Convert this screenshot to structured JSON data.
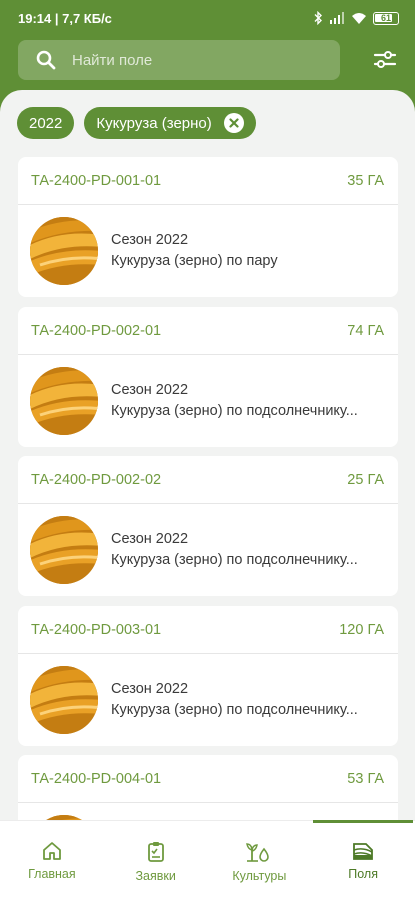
{
  "status_bar": {
    "time_speed": "19:14 | 7,7 КБ/с",
    "battery": "61"
  },
  "search": {
    "placeholder": "Найти поле",
    "icon": "search-icon"
  },
  "filters": {
    "icon": "sliders-icon",
    "chips": [
      {
        "label": "2022"
      },
      {
        "label": "Кукуруза (зерно)",
        "removable": true
      }
    ]
  },
  "fields": [
    {
      "id": "ТА-2400-PD-001-01",
      "area": "35 ГА",
      "season": "Сезон 2022",
      "crop": "Кукуруза (зерно) по пару"
    },
    {
      "id": "ТА-2400-PD-002-01",
      "area": "74 ГА",
      "season": "Сезон 2022",
      "crop": "Кукуруза (зерно) по подсолнечнику..."
    },
    {
      "id": "ТА-2400-PD-002-02",
      "area": "25 ГА",
      "season": "Сезон 2022",
      "crop": "Кукуруза (зерно) по подсолнечнику..."
    },
    {
      "id": "ТА-2400-PD-003-01",
      "area": "120 ГА",
      "season": "Сезон 2022",
      "crop": "Кукуруза (зерно) по подсолнечнику..."
    },
    {
      "id": "ТА-2400-PD-004-01",
      "area": "53 ГА",
      "season": "",
      "crop": ""
    }
  ],
  "nav": [
    {
      "label": "Главная",
      "icon": "home-icon"
    },
    {
      "label": "Заявки",
      "icon": "clipboard-icon"
    },
    {
      "label": "Культуры",
      "icon": "sprout-icon"
    },
    {
      "label": "Поля",
      "icon": "fields-icon",
      "active": true
    }
  ],
  "colors": {
    "brand_green": "#5f8f36",
    "text_green": "#6f9a3f",
    "background": "#f2f3f2"
  }
}
